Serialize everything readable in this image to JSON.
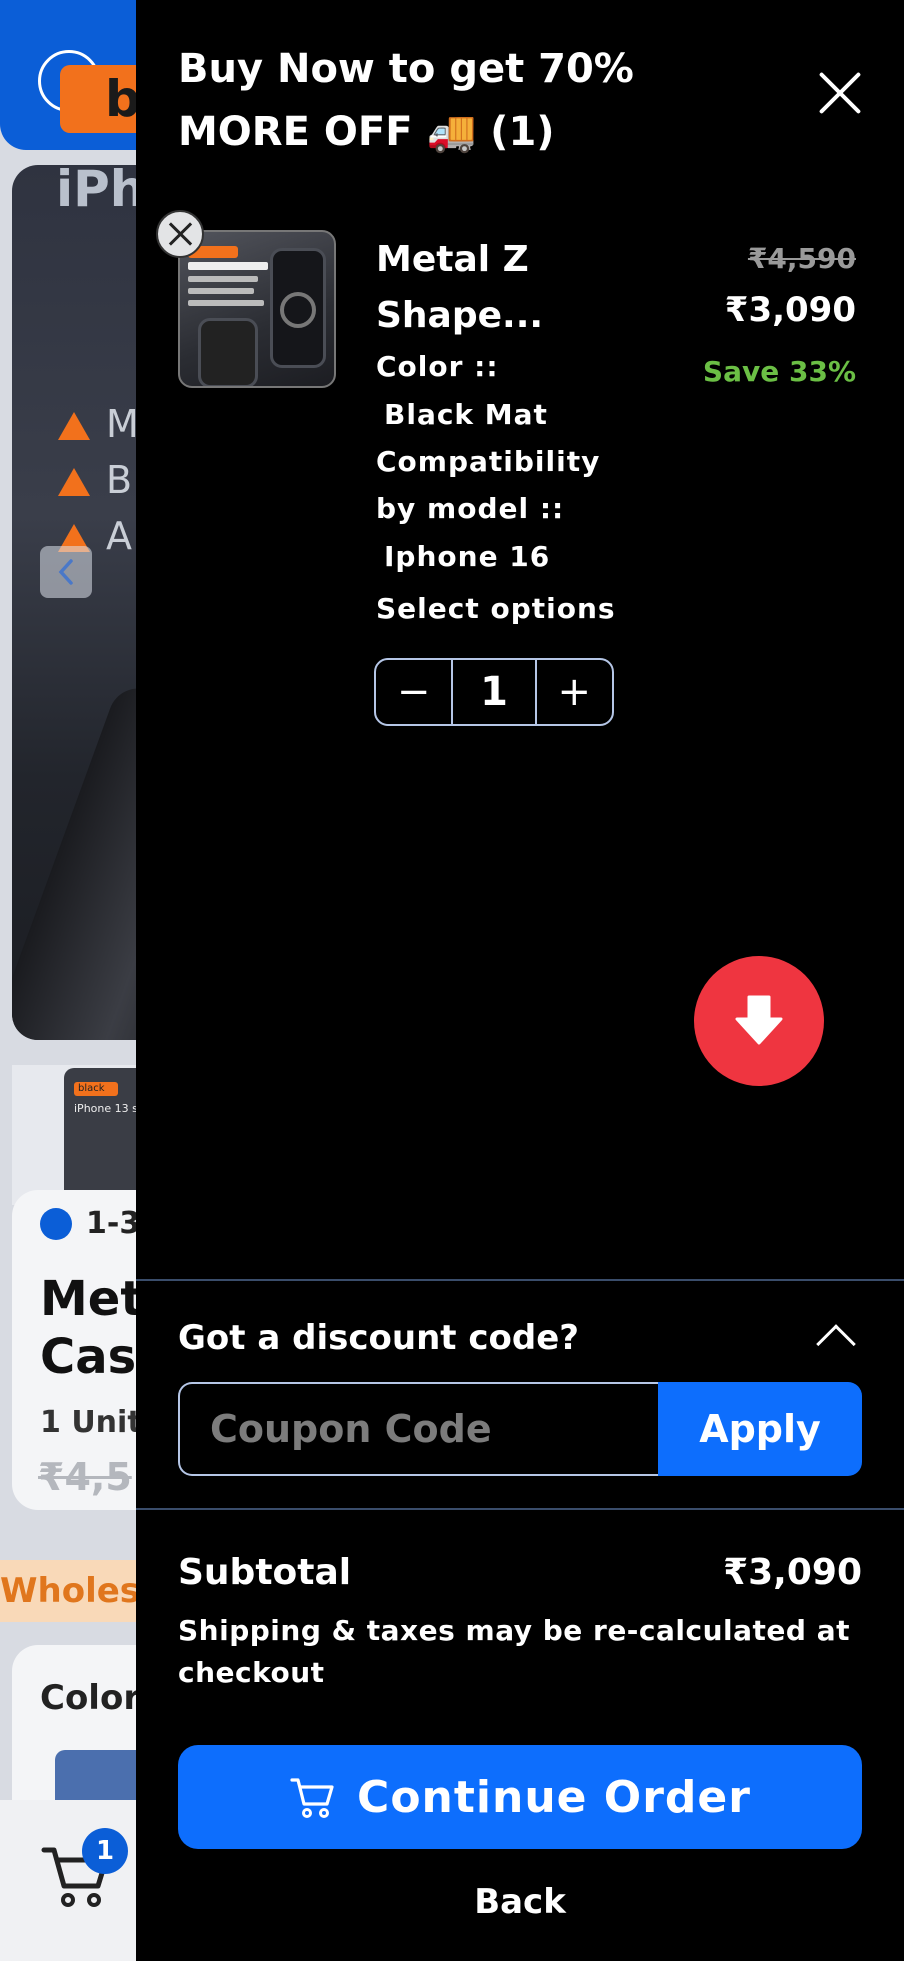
{
  "background_page": {
    "badge_fragment": "b",
    "title_fragment": "iPh",
    "features": [
      "M",
      "B",
      "A"
    ],
    "thumb_tag": "black",
    "thumb_text": "iPhone 13 s",
    "delivery_fragment": "1-3",
    "product_title_fragment_1": "Met",
    "product_title_fragment_2": "Case",
    "unit_fragment": "1 Unit",
    "strike_price_fragment": "₹4,5",
    "wholesale_fragment": "Wholesa",
    "color_label_fragment": "Color",
    "cart_count": "1"
  },
  "drawer": {
    "title": "Buy Now to get 70% MORE OFF 🚚 (1)",
    "item": {
      "name": "Metal Z Shape...",
      "original_price": "₹4,590",
      "price": "₹3,090",
      "save": "Save 33%",
      "color_label": "Color ::",
      "color_value": "Black Mat",
      "compat_label_1": "Compatibility",
      "compat_label_2": "by model ::",
      "compat_value": "Iphone 16",
      "select_options": "Select options",
      "quantity": "1",
      "qty_minus": "−",
      "qty_plus": "+",
      "image_tag": "black",
      "image_series": "iPhone 15 series"
    },
    "discount": {
      "title": "Got a discount code?",
      "placeholder": "Coupon Code",
      "apply": "Apply"
    },
    "subtotal": {
      "label": "Subtotal",
      "value": "₹3,090",
      "note": "Shipping & taxes may be re-calculated at checkout"
    },
    "continue_label": "Continue Order",
    "back_label": "Back"
  },
  "colors": {
    "accent_blue": "#0d6efd",
    "save_green": "#6bbf45",
    "fab_red": "#ef3540"
  }
}
